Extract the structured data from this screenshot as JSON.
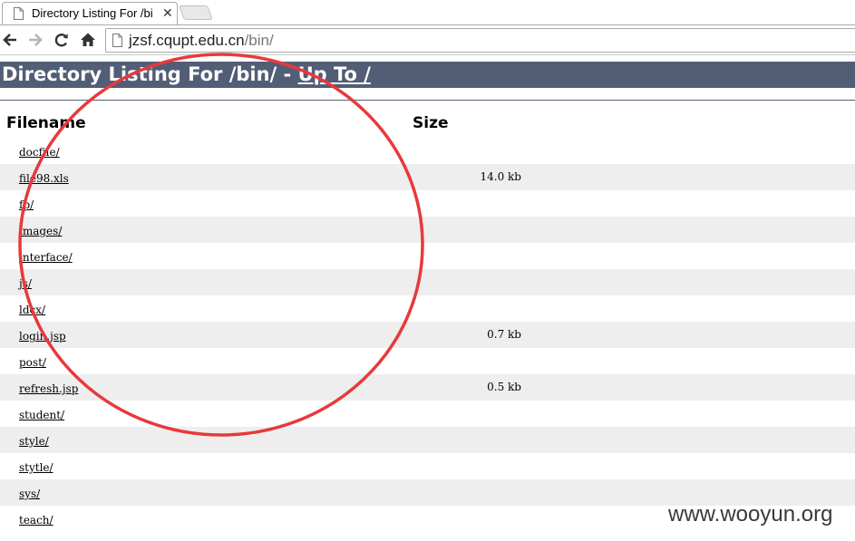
{
  "browser": {
    "tab_title": "Directory Listing For /bi",
    "tab_close_glyph": "✕",
    "url_host": "jzsf.cqupt.edu.cn",
    "url_path": "/bin/",
    "icons": [
      "page-icon",
      "back-arrow-icon",
      "forward-arrow-icon",
      "reload-icon",
      "home-icon"
    ]
  },
  "page": {
    "title_prefix": "Directory Listing For /bin/ - ",
    "up_to_label": "Up To /",
    "header_color": "#525d76",
    "columns": {
      "filename": "Filename",
      "size": "Size"
    },
    "files": [
      {
        "name": "docfile/",
        "size": ""
      },
      {
        "name": "file98.xls",
        "size": "14.0 kb"
      },
      {
        "name": "fp/",
        "size": ""
      },
      {
        "name": "images/",
        "size": ""
      },
      {
        "name": "interface/",
        "size": ""
      },
      {
        "name": "js/",
        "size": ""
      },
      {
        "name": "ldcx/",
        "size": ""
      },
      {
        "name": "login.jsp",
        "size": "0.7 kb"
      },
      {
        "name": "post/",
        "size": ""
      },
      {
        "name": "refresh.jsp",
        "size": "0.5 kb"
      },
      {
        "name": "student/",
        "size": ""
      },
      {
        "name": "style/",
        "size": ""
      },
      {
        "name": "stytle/",
        "size": ""
      },
      {
        "name": "sys/",
        "size": ""
      },
      {
        "name": "teach/",
        "size": ""
      }
    ]
  },
  "annotation": {
    "shape": "red circle",
    "color": "#e8393b"
  },
  "watermark": "www.wooyun.org"
}
